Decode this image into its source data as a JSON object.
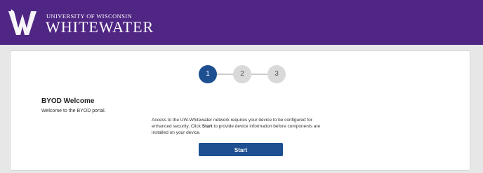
{
  "header": {
    "logo_small_text": "UNIVERSITY OF WISCONSIN",
    "logo_big_text": "WHITEWATER",
    "bg_color": "#4f2683"
  },
  "stepper": {
    "steps": [
      {
        "label": "1",
        "state": "active"
      },
      {
        "label": "2",
        "state": "inactive"
      },
      {
        "label": "3",
        "state": "inactive"
      }
    ],
    "current_step": 1
  },
  "welcome": {
    "title": "BYOD Welcome",
    "subtitle": "Welcome to the BYOD portal."
  },
  "info": {
    "part1": "Access to the UW-Whitewater network requires your device to be configured for enhanced security. Click ",
    "bold_word": "Start",
    "part2": " to provide device information before components are installed on your device."
  },
  "start_button": {
    "label": "Start",
    "color": "#1d4f91"
  }
}
